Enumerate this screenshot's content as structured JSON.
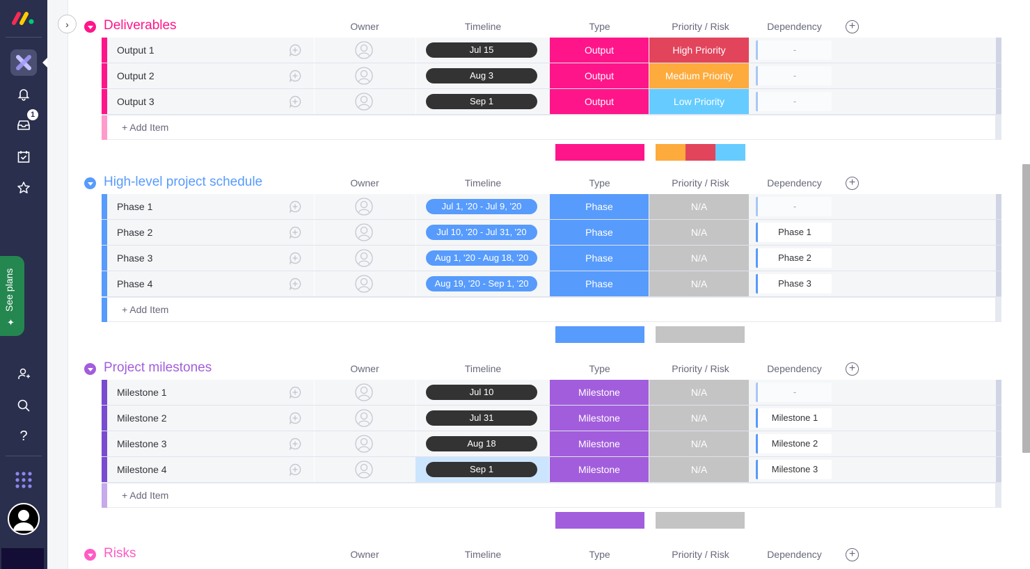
{
  "sidebar": {
    "logo": "monday-logo-icon",
    "icons": [
      "workspace-icon",
      "bell-icon",
      "inbox-icon",
      "calendar-check-icon",
      "star-icon",
      "invite-user-icon",
      "search-icon",
      "help-icon",
      "apps-grid-icon",
      "user-avatar-icon"
    ],
    "inbox_badge": "1",
    "see_plans_label": "See plans"
  },
  "columns": {
    "owner": "Owner",
    "timeline": "Timeline",
    "type": "Type",
    "priority": "Priority / Risk",
    "dependency": "Dependency",
    "add_column": "+"
  },
  "add_item_label": "+ Add Item",
  "colors": {
    "pink": "#ff158a",
    "pink_light": "#ff9acb",
    "blue": "#579bfc",
    "purple": "#a25ddc",
    "purple_bar": "#784bd1",
    "purple_light": "#c6aaeb",
    "dark_pill": "#333333",
    "high": "#e2445c",
    "medium": "#fdab3d",
    "low": "#66ccff",
    "na": "#c4c4c4"
  },
  "groups": [
    {
      "title": "Deliverables",
      "color": "#ff158a",
      "rows": [
        {
          "name": "Output 1",
          "timeline": "Jul 15",
          "type": "Output",
          "priority": "High Priority",
          "dependency": "-"
        },
        {
          "name": "Output 2",
          "timeline": "Aug 3",
          "type": "Output",
          "priority": "Medium Priority",
          "dependency": "-"
        },
        {
          "name": "Output 3",
          "timeline": "Sep 1",
          "type": "Output",
          "priority": "Low Priority",
          "dependency": "-"
        }
      ]
    },
    {
      "title": "High-level project schedule",
      "color": "#579bfc",
      "rows": [
        {
          "name": "Phase 1",
          "timeline": "Jul 1, '20 - Jul 9, '20",
          "type": "Phase",
          "priority": "N/A",
          "dependency": "-"
        },
        {
          "name": "Phase 2",
          "timeline": "Jul 10, '20 - Jul 31, '20",
          "type": "Phase",
          "priority": "N/A",
          "dependency": "Phase 1"
        },
        {
          "name": "Phase 3",
          "timeline": "Aug 1, '20 - Aug 18, '20",
          "type": "Phase",
          "priority": "N/A",
          "dependency": "Phase 2"
        },
        {
          "name": "Phase 4",
          "timeline": "Aug 19, '20 - Sep 1, '20",
          "type": "Phase",
          "priority": "N/A",
          "dependency": "Phase 3"
        }
      ]
    },
    {
      "title": "Project milestones",
      "color": "#a25ddc",
      "rows": [
        {
          "name": "Milestone 1",
          "timeline": "Jul 10",
          "type": "Milestone",
          "priority": "N/A",
          "dependency": "-"
        },
        {
          "name": "Milestone 2",
          "timeline": "Jul 31",
          "type": "Milestone",
          "priority": "N/A",
          "dependency": "Milestone 1"
        },
        {
          "name": "Milestone 3",
          "timeline": "Aug 18",
          "type": "Milestone",
          "priority": "N/A",
          "dependency": "Milestone 2"
        },
        {
          "name": "Milestone 4",
          "timeline": "Sep 1",
          "type": "Milestone",
          "priority": "N/A",
          "dependency": "Milestone 3"
        }
      ]
    },
    {
      "title": "Risks",
      "color": "#ff5ac4",
      "rows": []
    }
  ]
}
